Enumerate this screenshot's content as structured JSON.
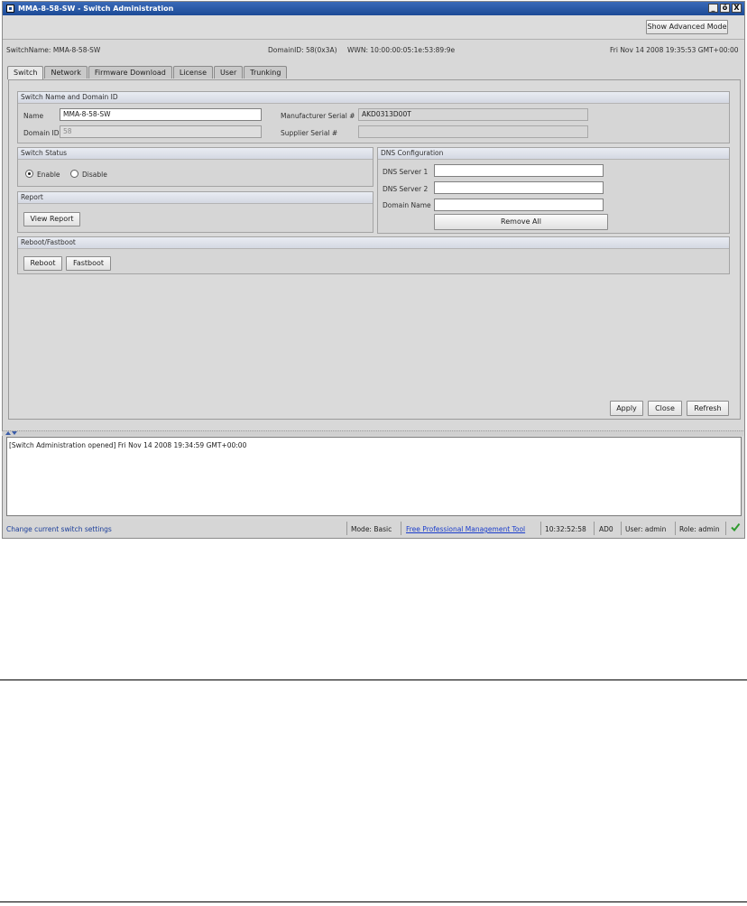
{
  "window": {
    "title": "MMA-8-58-SW - Switch Administration",
    "controls": [
      "_",
      "ő",
      "X"
    ]
  },
  "toolbar": {
    "advanced_mode_label": "Show Advanced Mode"
  },
  "info": {
    "switch_name": "SwitchName: MMA-8-58-SW",
    "domain_id": "DomainID: 58(0x3A)",
    "wwn": "WWN: 10:00:00:05:1e:53:89:9e",
    "datetime": "Fri Nov 14 2008 19:35:53 GMT+00:00"
  },
  "tabs": [
    {
      "label": "Switch",
      "active": true
    },
    {
      "label": "Network"
    },
    {
      "label": "Firmware Download"
    },
    {
      "label": "License"
    },
    {
      "label": "User"
    },
    {
      "label": "Trunking"
    }
  ],
  "switch_name_group": {
    "header": "Switch Name and Domain ID",
    "name_label": "Name",
    "name_value": "MMA-8-58-SW",
    "domain_label": "Domain ID",
    "domain_value": "58",
    "mfr_serial_label": "Manufacturer Serial #",
    "mfr_serial_value": "AKD0313D00T",
    "supplier_serial_label": "Supplier Serial #",
    "supplier_serial_value": ""
  },
  "switch_status": {
    "header": "Switch Status",
    "enable_label": "Enable",
    "disable_label": "Disable",
    "selected": "Enable"
  },
  "report": {
    "header": "Report",
    "view_label": "View Report"
  },
  "dns": {
    "header": "DNS Configuration",
    "server1_label": "DNS Server 1",
    "server1_value": "",
    "server2_label": "DNS Server 2",
    "server2_value": "",
    "domain_label": "Domain Name",
    "domain_value": "",
    "remove_all_label": "Remove All"
  },
  "reboot": {
    "header": "Reboot/Fastboot",
    "reboot_label": "Reboot",
    "fastboot_label": "Fastboot"
  },
  "actions": {
    "apply": "Apply",
    "close": "Close",
    "refresh": "Refresh"
  },
  "log": {
    "message": "[Switch Administration opened] Fri Nov 14 2008 19:34:59 GMT+00:00"
  },
  "status": {
    "left": "Change current switch settings",
    "mode": "Mode: Basic",
    "link": "Free Professional Management Tool",
    "time": "10:32:52:58",
    "ad": "AD0",
    "user": "User: admin",
    "role": "Role: admin",
    "ok_color": "#2e9a2e"
  }
}
